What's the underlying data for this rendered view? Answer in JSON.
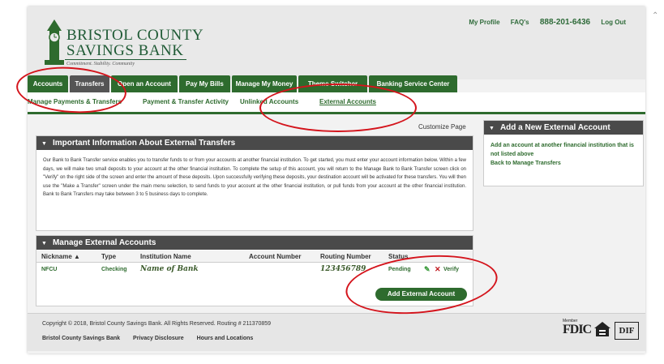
{
  "bank": {
    "name_line1": "BRISTOL COUNTY",
    "name_line2": "SAVINGS BANK",
    "tagline": "Commitment. Stability. Community"
  },
  "top_links": {
    "profile": "My Profile",
    "faqs": "FAQ's",
    "phone": "888-201-6436",
    "logout": "Log Out"
  },
  "main_nav": [
    "Accounts",
    "Transfers",
    "Open an Account",
    "Pay My Bills",
    "Manage My Money",
    "Theme Switcher",
    "Banking Service Center"
  ],
  "sub_nav": [
    "Manage Payments & Transfers",
    "Payment & Transfer Activity",
    "Unlinked Accounts",
    "External Accounts"
  ],
  "customize": "Customize Page",
  "info_panel": {
    "title": "Important Information About External Transfers",
    "body": "Our Bank to Bank Transfer service enables you to transfer funds to or from your accounts at another financial institution. To get started, you must enter your account information below. Within a few days, we will make two small deposits to your account at the other financial institution. To complete the setup of this account, you will return to the Manage Bank to Bank Transfer screen click on \"Verify\" on the right side of the screen and enter the amount of these deposits. Upon successfully verifying these deposits, your destination account will be activated for these transfers. You will then use the \"Make a Transfer\" screen under the main menu selection, to send funds to your account at the other financial institution, or pull funds from your account at the other financial institution. Bank to Bank Transfers may take between 3 to 5 business days to complete."
  },
  "manage_panel": {
    "title": "Manage External Accounts",
    "columns": [
      "Nickname ▲",
      "Type",
      "Institution Name",
      "Account Number",
      "Routing Number",
      "Status"
    ],
    "row": {
      "nickname": "NFCU",
      "type": "Checking",
      "institution": "Name of Bank",
      "account": "",
      "routing": "123456789",
      "status": "Pending",
      "verify": "Verify"
    },
    "add_button": "Add External Account"
  },
  "side_panel": {
    "title": "Add a New External Account",
    "link1": "Add an account at another financial institution that is not listed above",
    "link2": "Back to Manage Transfers"
  },
  "footer": {
    "copyright": "Copyright © 2018, Bristol County Savings Bank. All Rights Reserved. Routing # 211370859",
    "links": [
      "Bristol County Savings Bank",
      "Privacy Disclosure",
      "Hours and Locations"
    ],
    "fdic_member": "Member",
    "fdic": "FDIC",
    "dif": "DIF"
  },
  "colors": {
    "brand_green": "#2e6b2e",
    "header_dark": "#4a4a4a",
    "annotation_red": "#d4141c"
  }
}
